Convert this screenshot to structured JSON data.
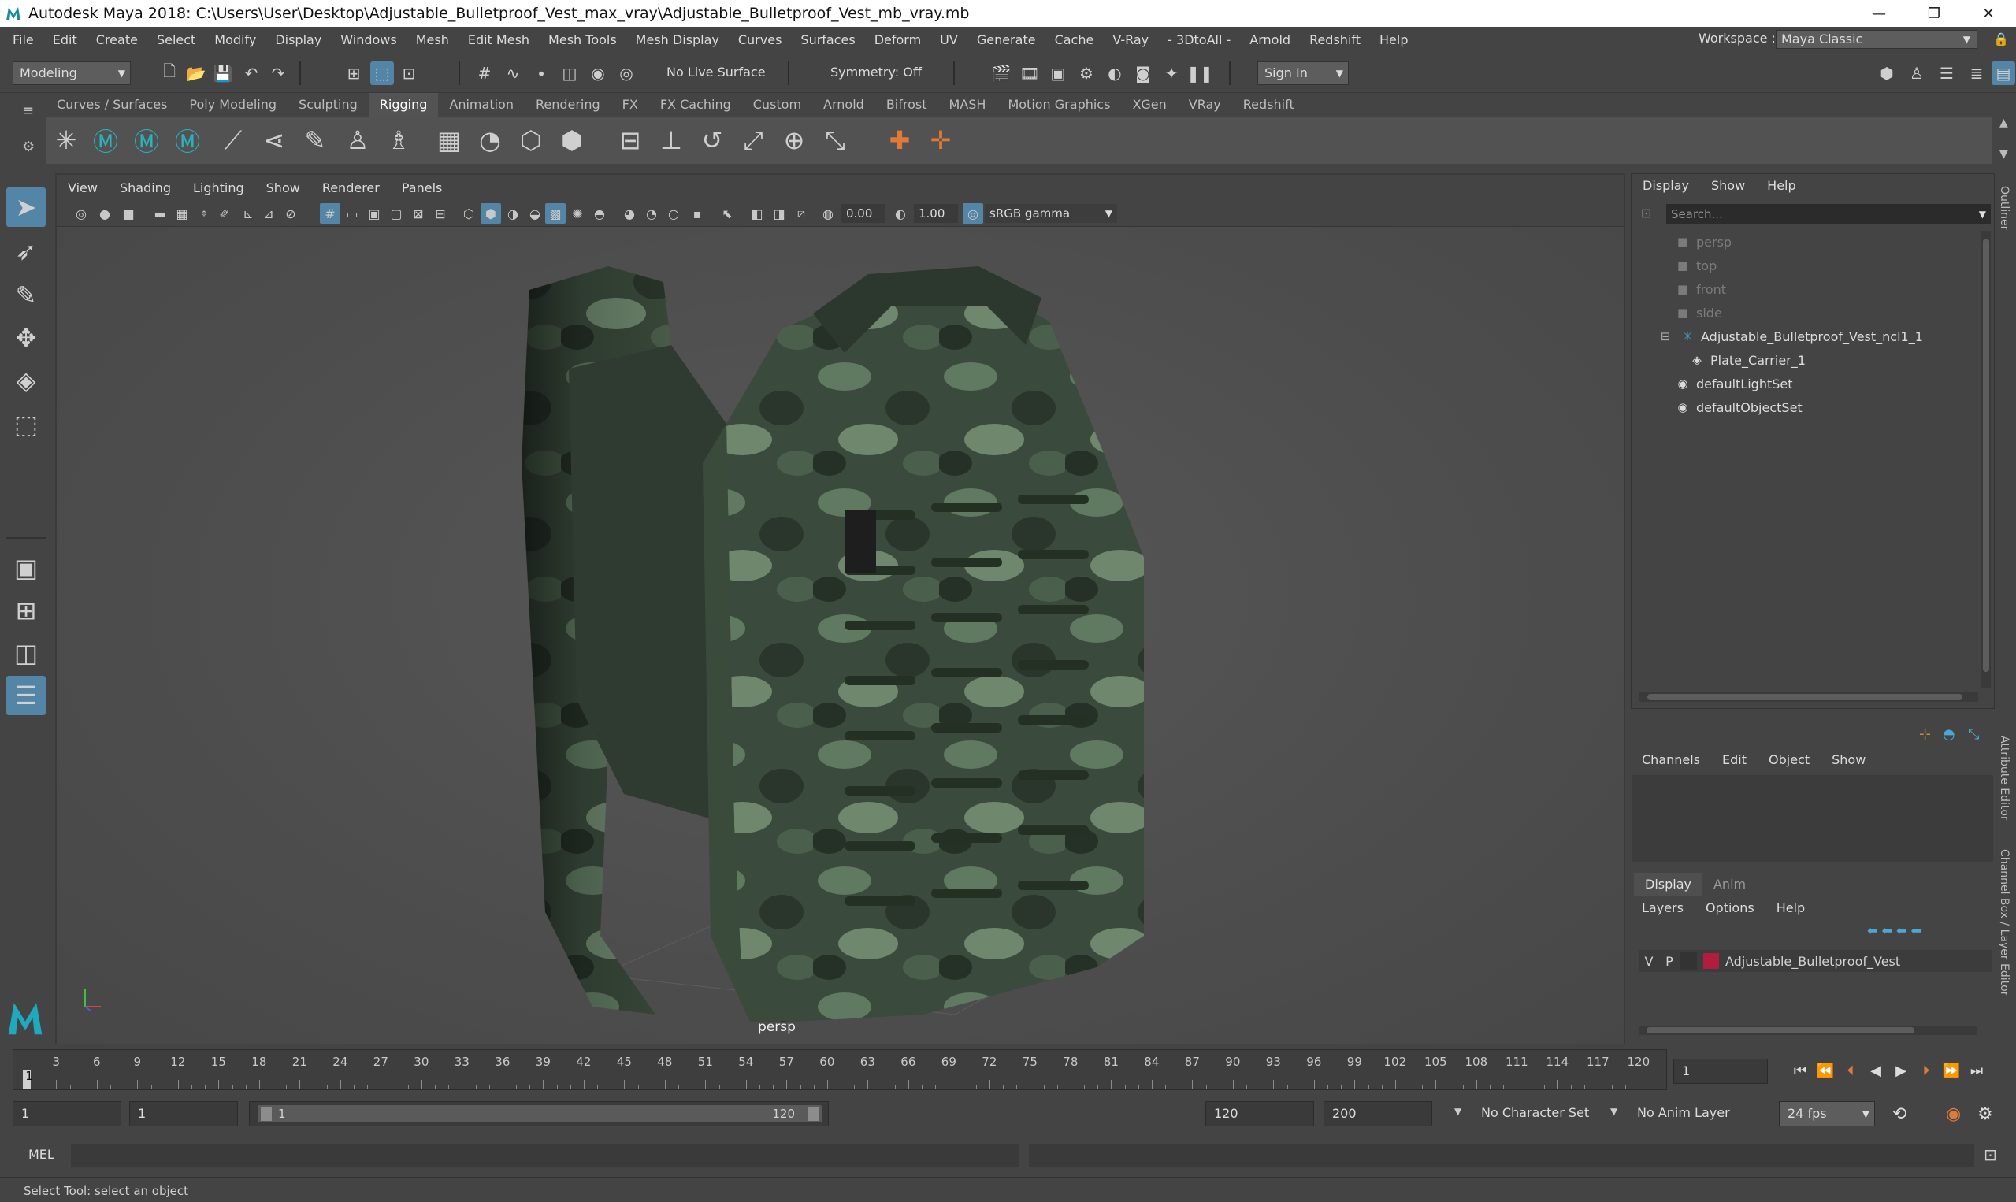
{
  "window": {
    "title": "Autodesk Maya 2018: C:\\Users\\User\\Desktop\\Adjustable_Bulletproof_Vest_max_vray\\Adjustable_Bulletproof_Vest_mb_vray.mb",
    "min": "—",
    "restore": "❐",
    "close": "✕"
  },
  "menubar": {
    "items": [
      "File",
      "Edit",
      "Create",
      "Select",
      "Modify",
      "Display",
      "Windows",
      "Mesh",
      "Edit Mesh",
      "Mesh Tools",
      "Mesh Display",
      "Curves",
      "Surfaces",
      "Deform",
      "UV",
      "Generate",
      "Cache",
      "V-Ray",
      "- 3DtoAll -",
      "Arnold",
      "Redshift",
      "Help"
    ],
    "workspace_label": "Workspace :",
    "workspace_value": "Maya Classic"
  },
  "statusline": {
    "mode": "Modeling",
    "live_surface": "No Live Surface",
    "symmetry": "Symmetry: Off",
    "sign_in": "Sign In"
  },
  "shelf": {
    "tabs": [
      "Curves / Surfaces",
      "Poly Modeling",
      "Sculpting",
      "Rigging",
      "Animation",
      "Rendering",
      "FX",
      "FX Caching",
      "Custom",
      "Arnold",
      "Bifrost",
      "MASH",
      "Motion Graphics",
      "XGen",
      "VRay",
      "Redshift"
    ],
    "active_tab": "Rigging"
  },
  "viewport": {
    "menu": [
      "View",
      "Shading",
      "Lighting",
      "Show",
      "Renderer",
      "Panels"
    ],
    "exposure": "0.00",
    "gamma": "1.00",
    "color_space": "sRGB gamma",
    "camera_label": "persp"
  },
  "outliner": {
    "menu": [
      "Display",
      "Show",
      "Help"
    ],
    "search_placeholder": "Search...",
    "items": [
      {
        "label": "persp",
        "icon": "camera-icon",
        "dim": true
      },
      {
        "label": "top",
        "icon": "camera-icon",
        "dim": true
      },
      {
        "label": "front",
        "icon": "camera-icon",
        "dim": true
      },
      {
        "label": "side",
        "icon": "camera-icon",
        "dim": true
      },
      {
        "label": "Adjustable_Bulletproof_Vest_ncl1_1",
        "icon": "joint-icon",
        "dim": false
      },
      {
        "label": "Plate_Carrier_1",
        "icon": "mesh-icon",
        "dim": false
      },
      {
        "label": "defaultLightSet",
        "icon": "set-icon",
        "dim": false
      },
      {
        "label": "defaultObjectSet",
        "icon": "set-icon",
        "dim": false
      }
    ],
    "side_tab": "Outliner"
  },
  "channels": {
    "menu": [
      "Channels",
      "Edit",
      "Object",
      "Show"
    ],
    "side_tab_attr": "Attribute Editor",
    "side_tab_channel": "Channel Box / Layer Editor"
  },
  "layers": {
    "tabs": [
      "Display",
      "Anim"
    ],
    "menu": [
      "Layers",
      "Options",
      "Help"
    ],
    "layer": {
      "v": "V",
      "p": "P",
      "name": "Adjustable_Bulletproof_Vest",
      "color": "#b11d3b"
    }
  },
  "timeline": {
    "ticks": [
      "3",
      "6",
      "9",
      "12",
      "15",
      "18",
      "21",
      "24",
      "27",
      "30",
      "33",
      "36",
      "39",
      "42",
      "45",
      "48",
      "51",
      "54",
      "57",
      "60",
      "63",
      "66",
      "69",
      "72",
      "75",
      "78",
      "81",
      "84",
      "87",
      "90",
      "93",
      "96",
      "99",
      "102",
      "105",
      "108",
      "111",
      "114",
      "117",
      "120"
    ],
    "start_tick": "1",
    "current_frame": "1"
  },
  "range": {
    "start": "1",
    "anim_start": "1",
    "bar_start": "1",
    "bar_end": "120",
    "end": "120",
    "anim_end": "200",
    "character_set": "No Character Set",
    "anim_layer": "No Anim Layer",
    "fps": "24 fps"
  },
  "cmd": {
    "mel": "MEL",
    "help": "Select Tool: select an object"
  },
  "colors": {
    "accent": "#5285a6",
    "panel": "#444444",
    "viewport": "#4c4c4c"
  }
}
